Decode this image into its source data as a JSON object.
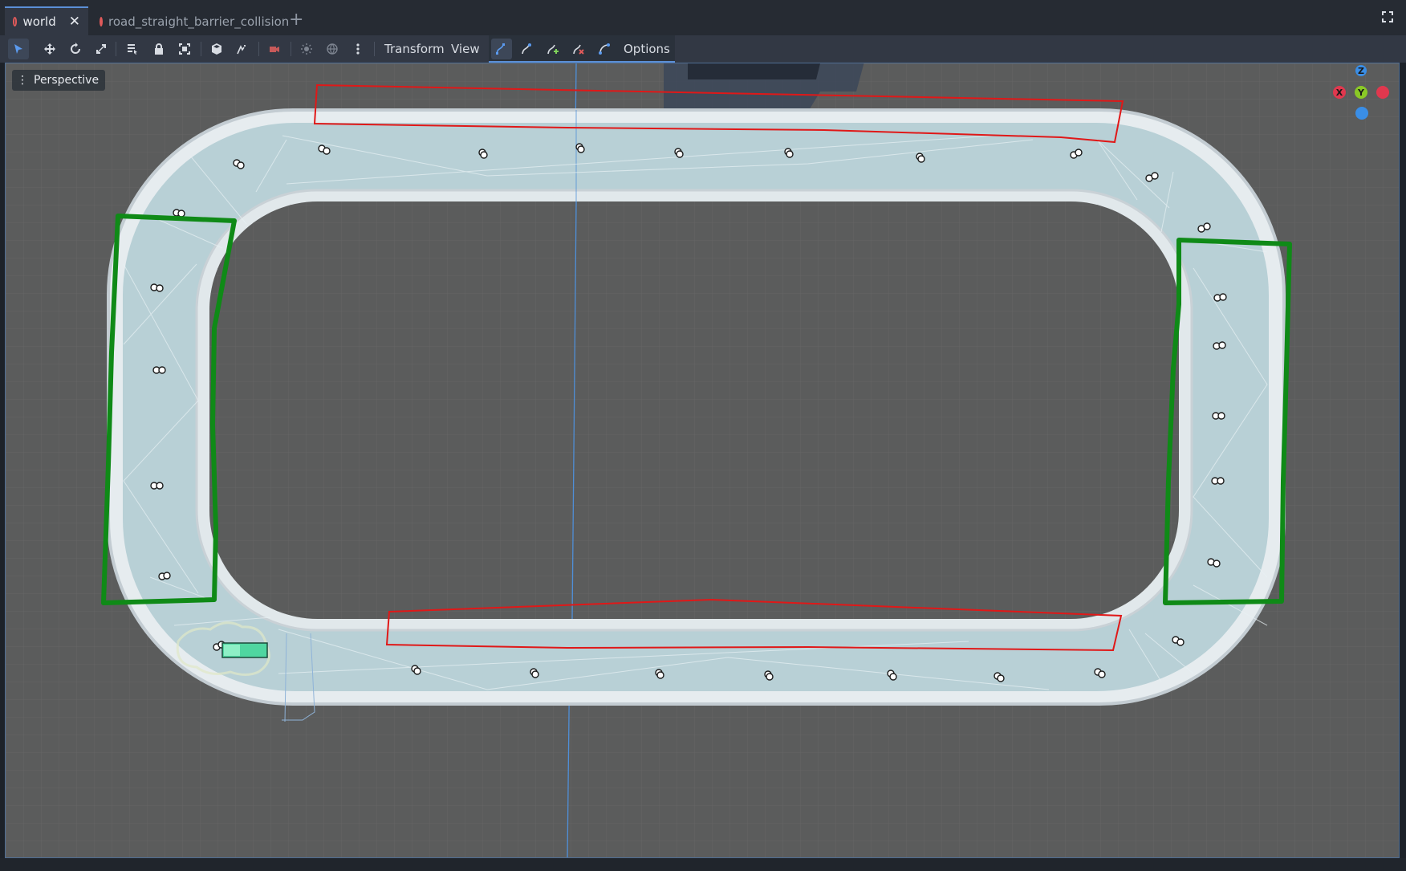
{
  "tabs": [
    {
      "label": "world",
      "active": true,
      "close_icon": "close-icon"
    },
    {
      "label": "road_straight_barrier_collision",
      "active": false
    }
  ],
  "add_tab_icon": "plus-icon",
  "fullscreen_icon": "fullscreen-icon",
  "toolbar": {
    "menus": {
      "transform": "Transform",
      "view": "View",
      "options": "Options"
    },
    "tools": [
      "select-icon",
      "move-icon",
      "rotate-icon",
      "scale-icon",
      "list-select-icon",
      "lock-icon",
      "group-icon",
      "use-local-space-icon",
      "snap-icon",
      "preview-camera-icon",
      "sun-icon",
      "environment-icon",
      "more-icon"
    ],
    "spline_tools": [
      "curve-select-icon",
      "curve-create-icon",
      "curve-add-point-icon",
      "curve-delete-point-icon",
      "curve-close-icon"
    ]
  },
  "viewport": {
    "mode_label": "Perspective",
    "axes": {
      "z": "Z",
      "x": "X",
      "y": "Y"
    },
    "colors": {
      "road": "#b6cdd4",
      "barrier": "#dfe6ea",
      "red_highlight": "#e01818",
      "green_highlight": "#0f8a17",
      "axis_x": "#e0384e",
      "axis_y": "#8ac926",
      "axis_z": "#3a8ee6"
    }
  }
}
